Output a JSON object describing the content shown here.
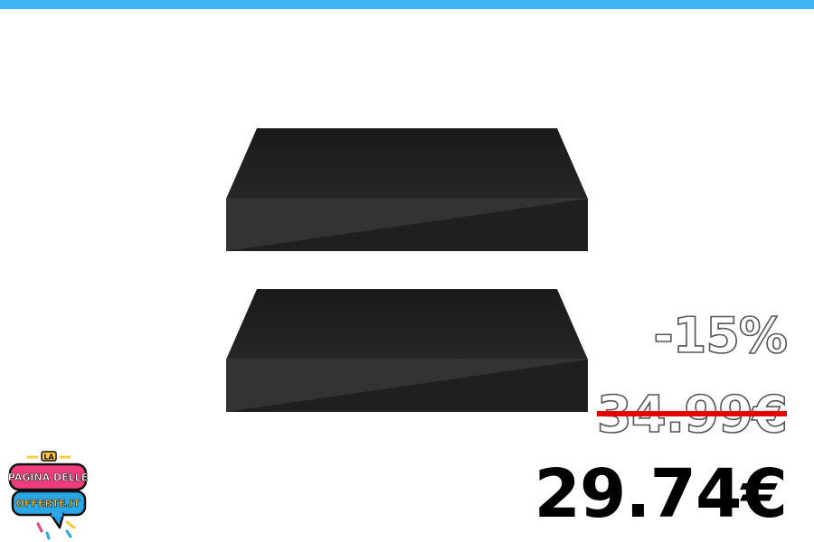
{
  "colors": {
    "top_bar": "#3db5f5",
    "strike": "#e60000",
    "logo_pink": "#ef3d7b",
    "logo_blue": "#2aa7e8",
    "logo_yellow": "#ffc93c"
  },
  "product": {
    "image_icon": "black-flat-box-stacked-image"
  },
  "pricing": {
    "discount": "-15%",
    "old_price": "34.99€",
    "current_price": "29.74€"
  },
  "logo": {
    "line1": "LA",
    "line2": "PAGINA DELLE",
    "line3": "OFFERTE.IT"
  }
}
